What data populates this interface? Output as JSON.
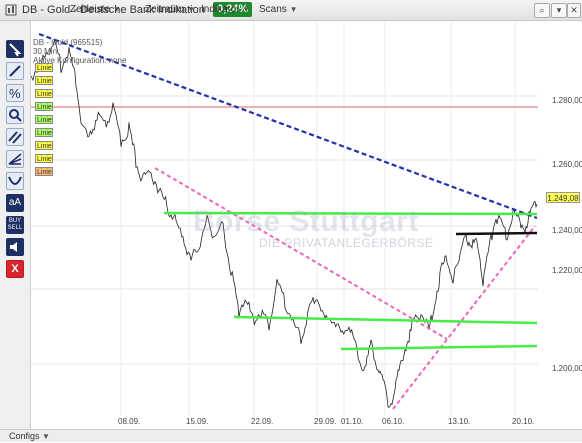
{
  "window": {
    "title": "DB - Gold - Deutsche Bank Indikation",
    "change_badge": "0,24%",
    "menu": [
      "Zeitleiste",
      "Zeitraum",
      "Indikator",
      "Scans"
    ],
    "controls": [
      "search-icon",
      "dropdown-icon",
      "close-icon"
    ]
  },
  "instrument": {
    "name": "DB - Gold (965515)",
    "interval": "30 Min",
    "config": "Aktive Konfiguration: none"
  },
  "legend": [
    {
      "label": "Linie",
      "color": "#ffff44"
    },
    {
      "label": "Linie",
      "color": "#ffff44"
    },
    {
      "label": "Linie",
      "color": "#ffff44"
    },
    {
      "label": "Linie",
      "color": "#aaff66"
    },
    {
      "label": "Linie",
      "color": "#aaff66"
    },
    {
      "label": "Linie",
      "color": "#aaff66"
    },
    {
      "label": "Linie",
      "color": "#ffff44"
    },
    {
      "label": "Linie",
      "color": "#ffff44"
    },
    {
      "label": "Linie",
      "color": "#ffbb77"
    }
  ],
  "watermark": {
    "main": "Börse Stuttgart",
    "sub": "DIE PRIVATANLEGERBÖRSE"
  },
  "y_axis": [
    "1.280,00",
    "1.260,00",
    "1.240,00",
    "1.220,00",
    "1.200,00"
  ],
  "x_axis": [
    "08.09.",
    "15.09.",
    "22.09.",
    "29.09.",
    "01.10.",
    "06.10.",
    "13.10.",
    "20.10."
  ],
  "current_price": "1.249,08",
  "statusbar": {
    "configs_label": "Configs"
  },
  "colors": {
    "accent": "#1e8a2e",
    "trend_blue": "#2233aa",
    "trend_pink": "#ee66bb",
    "support_green": "#44ee44",
    "resistance_red": "#d66"
  }
}
